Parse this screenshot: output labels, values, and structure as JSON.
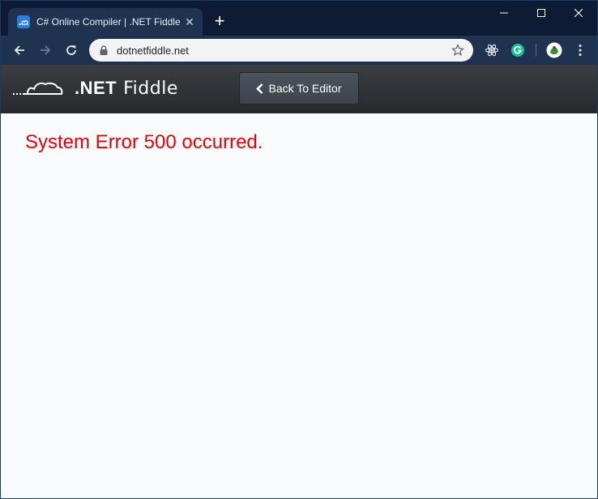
{
  "browser": {
    "tab": {
      "title": "C# Online Compiler | .NET Fiddle",
      "close_symbol": "✕"
    },
    "new_tab_symbol": "+",
    "address": {
      "url": "dotnetfiddle.net"
    },
    "icons": [
      "back-arrow-icon",
      "forward-arrow-icon",
      "reload-icon",
      "lock-icon",
      "star-icon",
      "react-devtools-icon",
      "grammarly-icon",
      "profile-avatar-icon",
      "menu-dots-icon",
      "minimize-icon",
      "maximize-icon",
      "close-icon"
    ]
  },
  "site": {
    "logo_net": ".NET",
    "logo_fiddle": "Fiddle",
    "back_button_label": "Back To Editor"
  },
  "main": {
    "error_message": "System Error 500 occurred."
  },
  "colors": {
    "error": "#e8000b",
    "header_bg": "#2f3337",
    "browser_frame": "#0d1b33",
    "toolbar": "#1f3350"
  }
}
